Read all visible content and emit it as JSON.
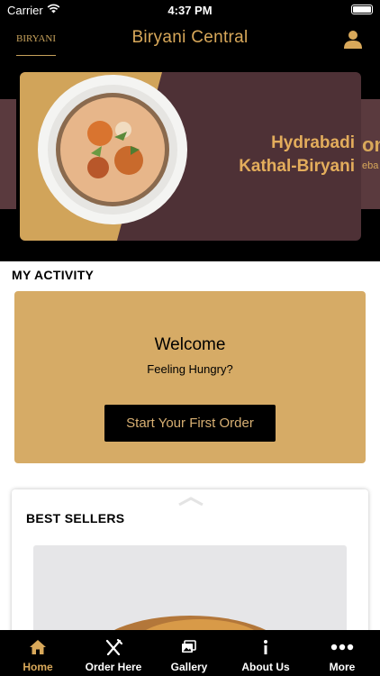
{
  "status_bar": {
    "carrier": "Carrier",
    "time": "4:37 PM"
  },
  "header": {
    "title": "Biryani Central",
    "logo_text": "BIRYANI"
  },
  "banner": {
    "line1": "Hydrabadi",
    "line2": "Kathal-Biryani",
    "peek_text": "on",
    "peek_sub": "eba"
  },
  "activity": {
    "section_title": "MY ACTIVITY",
    "welcome_title": "Welcome",
    "welcome_subtitle": "Feeling Hungry?",
    "cta_label": "Start Your First Order"
  },
  "best_sellers": {
    "title": "BEST SELLERS"
  },
  "tabs": [
    {
      "label": "Home",
      "icon": "home-icon",
      "active": true
    },
    {
      "label": "Order Here",
      "icon": "fork-knife-icon",
      "active": false
    },
    {
      "label": "Gallery",
      "icon": "gallery-icon",
      "active": false
    },
    {
      "label": "About Us",
      "icon": "info-icon",
      "active": false
    },
    {
      "label": "More",
      "icon": "more-icon",
      "active": false
    }
  ],
  "colors": {
    "brand_gold": "#d8a85a",
    "banner_maroon": "#4e3136",
    "welcome_bg": "#d6ab66"
  }
}
